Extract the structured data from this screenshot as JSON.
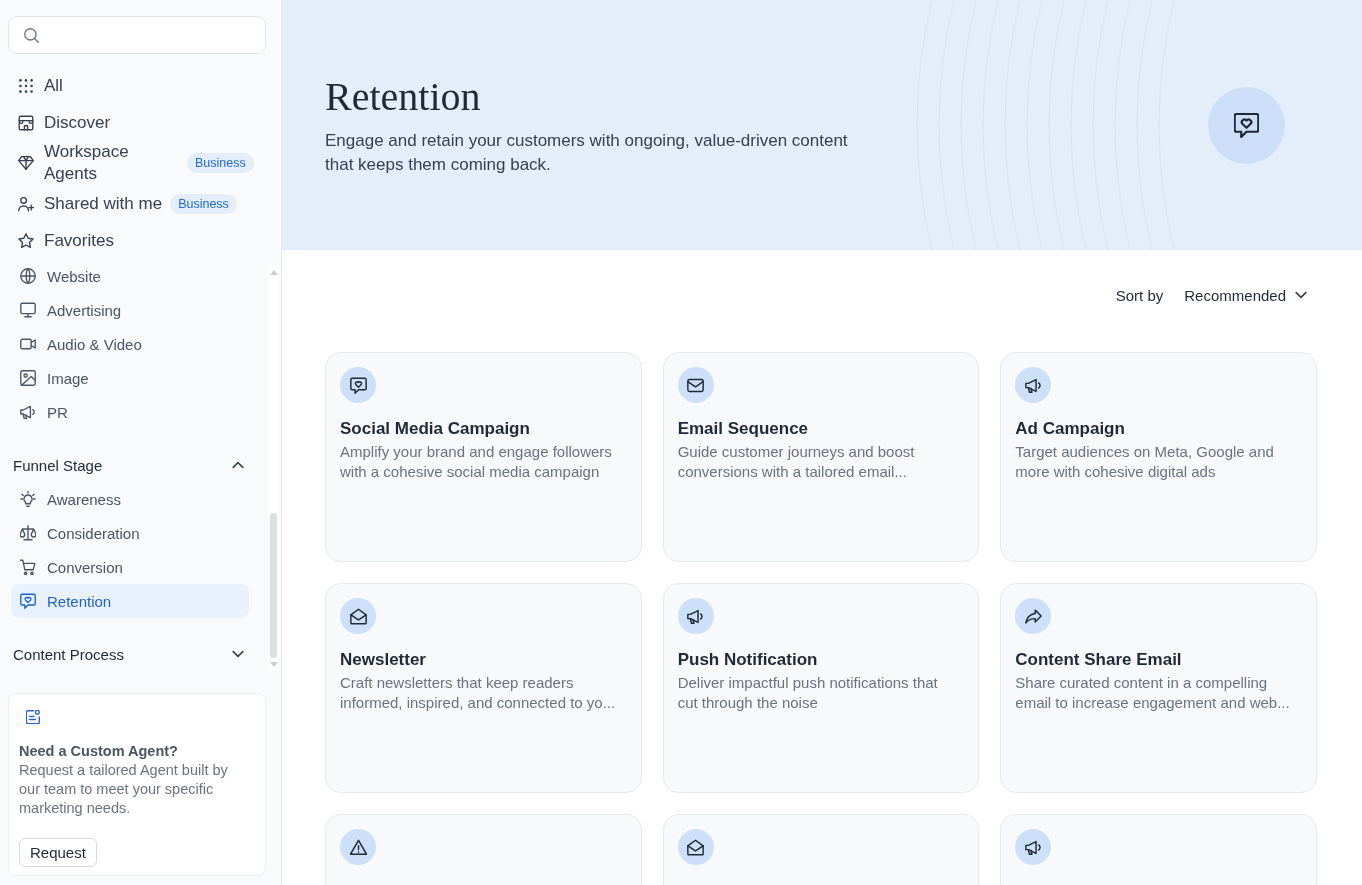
{
  "sidebar": {
    "nav_items": [
      {
        "label": "All",
        "selected": false
      },
      {
        "label": "Discover",
        "selected": false
      },
      {
        "label": "Workspace Agents",
        "badge": "Business",
        "selected": false
      },
      {
        "label": "Shared with me",
        "badge": "Business",
        "selected": false
      },
      {
        "label": "Favorites",
        "selected": false
      }
    ],
    "categories": [
      {
        "label": "Website",
        "selected": false
      },
      {
        "label": "Advertising",
        "selected": false
      },
      {
        "label": "Audio & Video",
        "selected": false
      },
      {
        "label": "Image",
        "selected": false
      },
      {
        "label": "PR",
        "selected": false
      }
    ],
    "sections": [
      {
        "title": "Funnel Stage",
        "expanded": true,
        "items": [
          {
            "label": "Awareness",
            "selected": false
          },
          {
            "label": "Consideration",
            "selected": false
          },
          {
            "label": "Conversion",
            "selected": false
          },
          {
            "label": "Retention",
            "selected": true
          }
        ]
      },
      {
        "title": "Content Process",
        "expanded": false
      }
    ],
    "custom_agent": {
      "title": "Need a Custom Agent?",
      "description": "Request a tailored Agent built by our team to meet your specific marketing needs.",
      "button": "Request"
    }
  },
  "header": {
    "title": "Retention",
    "description": "Engage and retain your customers with ongoing, value-driven content that keeps them coming back."
  },
  "sort": {
    "label": "Sort by",
    "value": "Recommended"
  },
  "cards": [
    {
      "kind": "full",
      "title": "Social Media Campaign",
      "description": "Amplify your brand and engage followers with a cohesive social media campaign"
    },
    {
      "kind": "full",
      "title": "Email Sequence",
      "description": "Guide customer journeys and boost conversions with a tailored email..."
    },
    {
      "kind": "full",
      "title": "Ad Campaign",
      "description": "Target audiences on Meta, Google and more with cohesive digital ads"
    },
    {
      "kind": "full",
      "title": "Newsletter",
      "description": "Craft newsletters that keep readers informed, inspired, and connected to yo..."
    },
    {
      "kind": "full",
      "title": "Push Notification",
      "description": "Deliver impactful push notifications that cut through the noise"
    },
    {
      "kind": "full",
      "title": "Content Share Email",
      "description": "Share curated content in a compelling email to increase engagement and web..."
    },
    {
      "kind": "partial"
    },
    {
      "kind": "partial"
    },
    {
      "kind": "partial"
    }
  ]
}
